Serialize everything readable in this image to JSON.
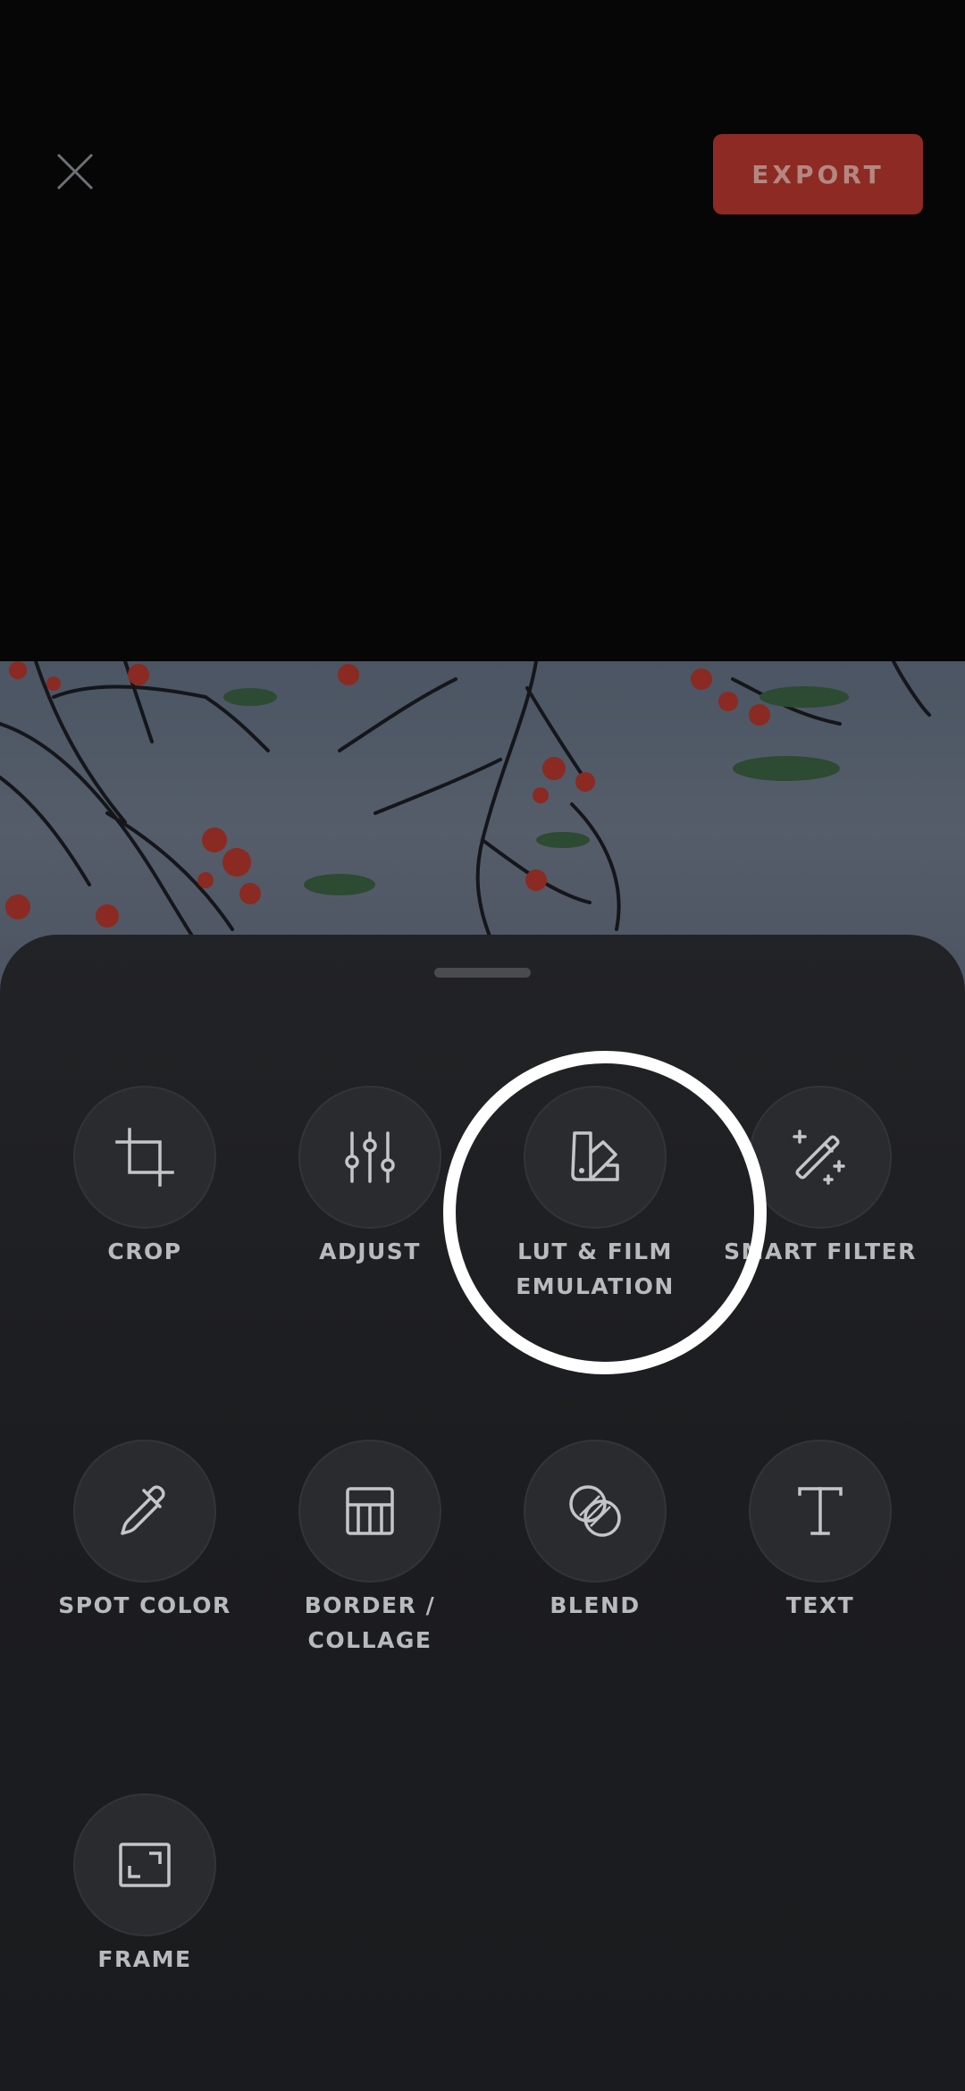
{
  "topbar": {
    "close_icon": "close-icon",
    "export_label": "EXPORT",
    "export_color": "#8c2a23"
  },
  "tools": [
    {
      "label": "CROP",
      "icon": "crop-icon"
    },
    {
      "label": "ADJUST",
      "icon": "sliders-icon"
    },
    {
      "label": "LUT & FILM\nEMULATION",
      "icon": "swatch-book-icon"
    },
    {
      "label": "SMART FILTER",
      "icon": "magic-wand-icon"
    },
    {
      "label": "SPOT COLOR",
      "icon": "eyedropper-icon"
    },
    {
      "label": "BORDER /\nCOLLAGE",
      "icon": "border-grid-icon"
    },
    {
      "label": "BLEND",
      "icon": "blend-circles-icon"
    },
    {
      "label": "TEXT",
      "icon": "text-icon"
    },
    {
      "label": "FRAME",
      "icon": "frame-icon"
    }
  ],
  "highlight": {
    "target": "LUT & FILM\nEMULATION",
    "color": "#ffffff"
  }
}
